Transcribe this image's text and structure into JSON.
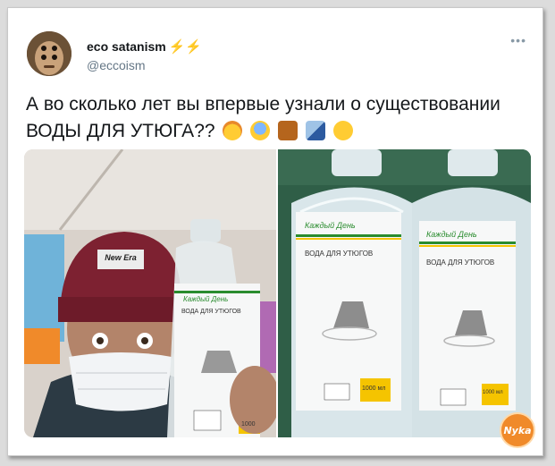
{
  "tweet": {
    "display_name": "eco satanism",
    "name_emoji": "⚡⚡",
    "handle": "@eccoism",
    "more_icon": "•••",
    "text": "А во сколько лет вы впервые узнали о существовании ВОДЫ ДЛЯ УТЮГА??",
    "emojis": [
      "exploding-head",
      "screaming-face",
      "horse-racing",
      "high-speed-train",
      "thinking-face"
    ]
  },
  "photos": {
    "left": {
      "hat_text": "New Era",
      "bottle_brand": "Каждый День",
      "bottle_label": "ВОДА ДЛЯ УТЮГОВ",
      "bottle_volume": "1000"
    },
    "right": {
      "bottle_brand": "Каждый День",
      "bottle_label": "ВОДА ДЛЯ УТЮГОВ",
      "bottle_volume": "1000 мл"
    }
  },
  "watermark": "Nyka",
  "colors": {
    "brand_green": "#2a8c2e",
    "brand_yellow": "#f5c400",
    "bolt_yellow": "#f2b705",
    "text_dark": "#14171a",
    "text_muted": "#657786"
  }
}
